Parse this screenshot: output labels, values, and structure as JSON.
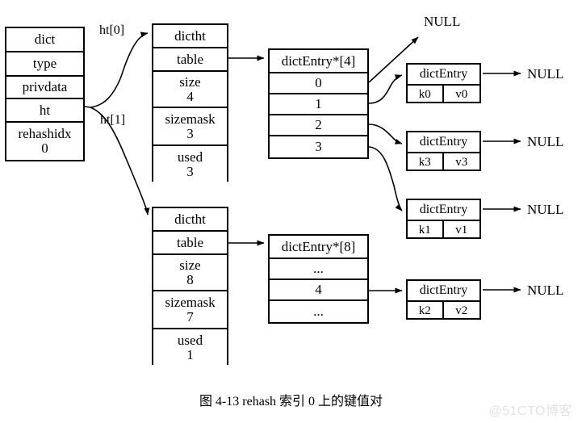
{
  "caption": "图 4-13    rehash 索引 0 上的键值对",
  "watermark": "@51CTO博客",
  "dict": {
    "title": "dict",
    "fields": [
      {
        "label": "type"
      },
      {
        "label": "privdata"
      },
      {
        "label": "ht"
      },
      {
        "label": "rehashidx",
        "value": "0"
      }
    ]
  },
  "pointers": {
    "ht0": "ht[0]",
    "ht1": "ht[1]"
  },
  "hashtables": [
    {
      "title": "dictht",
      "table_label": "table",
      "size_label": "size",
      "size_value": "4",
      "sizemask_label": "sizemask",
      "sizemask_value": "3",
      "used_label": "used",
      "used_value": "3"
    },
    {
      "title": "dictht",
      "table_label": "table",
      "size_label": "size",
      "size_value": "8",
      "sizemask_label": "sizemask",
      "sizemask_value": "7",
      "used_label": "used",
      "used_value": "1"
    }
  ],
  "arrays": [
    {
      "title": "dictEntry*[4]",
      "cells": [
        "0",
        "1",
        "2",
        "3"
      ]
    },
    {
      "title": "dictEntry*[8]",
      "cells": [
        "...",
        "4",
        "..."
      ]
    }
  ],
  "entries": [
    {
      "title": "dictEntry",
      "key": "k0",
      "value": "v0",
      "next": "NULL"
    },
    {
      "title": "dictEntry",
      "key": "k3",
      "value": "v3",
      "next": "NULL"
    },
    {
      "title": "dictEntry",
      "key": "k1",
      "value": "v1",
      "next": "NULL"
    },
    {
      "title": "dictEntry",
      "key": "k2",
      "value": "v2",
      "next": "NULL"
    }
  ],
  "null_top": "NULL",
  "colors": {
    "stroke": "#000000",
    "background": "#ffffff",
    "watermark": "#e2e2e2"
  }
}
